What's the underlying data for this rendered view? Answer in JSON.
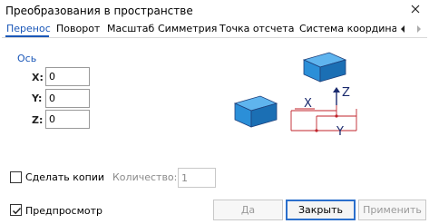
{
  "window": {
    "title": "Преобразования в пространстве"
  },
  "tabs": [
    {
      "label": "Перенос",
      "active": true
    },
    {
      "label": "Поворот",
      "active": false
    },
    {
      "label": "Масштаб",
      "active": false
    },
    {
      "label": "Симметрия",
      "active": false
    },
    {
      "label": "Точка отсчета",
      "active": false
    },
    {
      "label": "Система координат",
      "active": false
    }
  ],
  "axis_group": {
    "title": "Ось",
    "fields": [
      {
        "label": "X:",
        "value": "0"
      },
      {
        "label": "Y:",
        "value": "0"
      },
      {
        "label": "Z:",
        "value": "0"
      }
    ]
  },
  "illustration": {
    "labels": {
      "x": "X",
      "y": "Y",
      "z": "Z"
    },
    "colors": {
      "box_top": "#5fb4ee",
      "box_front": "#2b8fd8",
      "box_side": "#1b6fb4",
      "box_edge": "#1e3f7a",
      "dimension_line": "#c0232b",
      "axis_arrow": "#1a2a6e"
    }
  },
  "options": {
    "make_copies_label": "Сделать копии",
    "make_copies_checked": false,
    "count_label": "Количество:",
    "count_value": "1",
    "preview_label": "Предпросмотр",
    "preview_checked": true
  },
  "buttons": {
    "ok": "Да",
    "close": "Закрыть",
    "apply": "Применить"
  },
  "colors": {
    "accent": "#1a57b8",
    "disabled_text": "#9a9a9a"
  }
}
